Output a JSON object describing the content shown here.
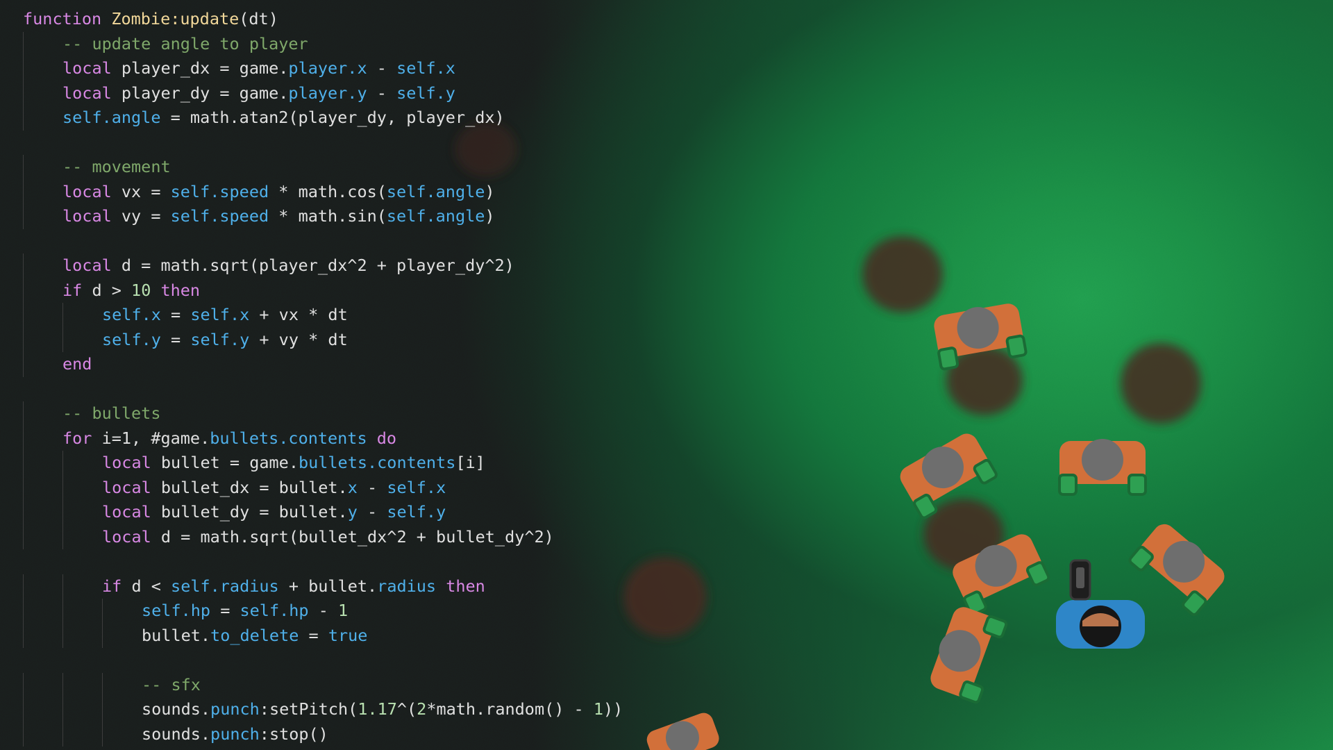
{
  "code_lines": [
    {
      "indent": 0,
      "segments": [
        {
          "t": "function ",
          "c": "kw"
        },
        {
          "t": "Zombie:update",
          "c": "fn"
        },
        {
          "t": "(dt)",
          "c": "lc"
        }
      ]
    },
    {
      "indent": 1,
      "segments": [
        {
          "t": "-- update angle to player",
          "c": "cm"
        }
      ]
    },
    {
      "indent": 1,
      "segments": [
        {
          "t": "local ",
          "c": "kw"
        },
        {
          "t": "player_dx = game.",
          "c": "lc"
        },
        {
          "t": "player.x",
          "c": "sf"
        },
        {
          "t": " - ",
          "c": "lc"
        },
        {
          "t": "self",
          "c": "sf"
        },
        {
          "t": ".x",
          "c": "sf"
        }
      ]
    },
    {
      "indent": 1,
      "segments": [
        {
          "t": "local ",
          "c": "kw"
        },
        {
          "t": "player_dy = game.",
          "c": "lc"
        },
        {
          "t": "player.y",
          "c": "sf"
        },
        {
          "t": " - ",
          "c": "lc"
        },
        {
          "t": "self",
          "c": "sf"
        },
        {
          "t": ".y",
          "c": "sf"
        }
      ]
    },
    {
      "indent": 1,
      "segments": [
        {
          "t": "self",
          "c": "sf"
        },
        {
          "t": ".angle",
          "c": "sf"
        },
        {
          "t": " = math.atan2(player_dy, player_dx)",
          "c": "lc"
        }
      ]
    },
    {
      "indent": 0,
      "segments": []
    },
    {
      "indent": 1,
      "segments": [
        {
          "t": "-- movement",
          "c": "cm"
        }
      ]
    },
    {
      "indent": 1,
      "segments": [
        {
          "t": "local ",
          "c": "kw"
        },
        {
          "t": "vx = ",
          "c": "lc"
        },
        {
          "t": "self",
          "c": "sf"
        },
        {
          "t": ".speed",
          "c": "sf"
        },
        {
          "t": " * math.cos(",
          "c": "lc"
        },
        {
          "t": "self",
          "c": "sf"
        },
        {
          "t": ".angle",
          "c": "sf"
        },
        {
          "t": ")",
          "c": "lc"
        }
      ]
    },
    {
      "indent": 1,
      "segments": [
        {
          "t": "local ",
          "c": "kw"
        },
        {
          "t": "vy = ",
          "c": "lc"
        },
        {
          "t": "self",
          "c": "sf"
        },
        {
          "t": ".speed",
          "c": "sf"
        },
        {
          "t": " * math.sin(",
          "c": "lc"
        },
        {
          "t": "self",
          "c": "sf"
        },
        {
          "t": ".angle",
          "c": "sf"
        },
        {
          "t": ")",
          "c": "lc"
        }
      ]
    },
    {
      "indent": 0,
      "segments": []
    },
    {
      "indent": 1,
      "segments": [
        {
          "t": "local ",
          "c": "kw"
        },
        {
          "t": "d = math.sqrt(player_dx^2 + player_dy^2)",
          "c": "lc"
        }
      ]
    },
    {
      "indent": 1,
      "segments": [
        {
          "t": "if ",
          "c": "kw"
        },
        {
          "t": "d > ",
          "c": "lc"
        },
        {
          "t": "10",
          "c": "nm"
        },
        {
          "t": " then",
          "c": "kw"
        }
      ]
    },
    {
      "indent": 2,
      "segments": [
        {
          "t": "self",
          "c": "sf"
        },
        {
          "t": ".x",
          "c": "sf"
        },
        {
          "t": " = ",
          "c": "lc"
        },
        {
          "t": "self",
          "c": "sf"
        },
        {
          "t": ".x",
          "c": "sf"
        },
        {
          "t": " + vx * dt",
          "c": "lc"
        }
      ]
    },
    {
      "indent": 2,
      "segments": [
        {
          "t": "self",
          "c": "sf"
        },
        {
          "t": ".y",
          "c": "sf"
        },
        {
          "t": " = ",
          "c": "lc"
        },
        {
          "t": "self",
          "c": "sf"
        },
        {
          "t": ".y",
          "c": "sf"
        },
        {
          "t": " + vy * dt",
          "c": "lc"
        }
      ]
    },
    {
      "indent": 1,
      "segments": [
        {
          "t": "end",
          "c": "kw"
        }
      ]
    },
    {
      "indent": 0,
      "segments": []
    },
    {
      "indent": 1,
      "segments": [
        {
          "t": "-- bullets",
          "c": "cm"
        }
      ]
    },
    {
      "indent": 1,
      "segments": [
        {
          "t": "for ",
          "c": "kw"
        },
        {
          "t": "i=1, #game.",
          "c": "lc"
        },
        {
          "t": "bullets.contents",
          "c": "sf"
        },
        {
          "t": " do",
          "c": "kw"
        }
      ]
    },
    {
      "indent": 2,
      "segments": [
        {
          "t": "local ",
          "c": "kw"
        },
        {
          "t": "bullet = game.",
          "c": "lc"
        },
        {
          "t": "bullets.contents",
          "c": "sf"
        },
        {
          "t": "[i]",
          "c": "lc"
        }
      ]
    },
    {
      "indent": 2,
      "segments": [
        {
          "t": "local ",
          "c": "kw"
        },
        {
          "t": "bullet_dx = bullet.",
          "c": "lc"
        },
        {
          "t": "x",
          "c": "sf"
        },
        {
          "t": " - ",
          "c": "lc"
        },
        {
          "t": "self",
          "c": "sf"
        },
        {
          "t": ".x",
          "c": "sf"
        }
      ]
    },
    {
      "indent": 2,
      "segments": [
        {
          "t": "local ",
          "c": "kw"
        },
        {
          "t": "bullet_dy = bullet.",
          "c": "lc"
        },
        {
          "t": "y",
          "c": "sf"
        },
        {
          "t": " - ",
          "c": "lc"
        },
        {
          "t": "self",
          "c": "sf"
        },
        {
          "t": ".y",
          "c": "sf"
        }
      ]
    },
    {
      "indent": 2,
      "segments": [
        {
          "t": "local ",
          "c": "kw"
        },
        {
          "t": "d = math.sqrt(bullet_dx^2 + bullet_dy^2)",
          "c": "lc"
        }
      ]
    },
    {
      "indent": 0,
      "segments": []
    },
    {
      "indent": 2,
      "segments": [
        {
          "t": "if ",
          "c": "kw"
        },
        {
          "t": "d < ",
          "c": "lc"
        },
        {
          "t": "self",
          "c": "sf"
        },
        {
          "t": ".radius",
          "c": "sf"
        },
        {
          "t": " + bullet.",
          "c": "lc"
        },
        {
          "t": "radius",
          "c": "sf"
        },
        {
          "t": " then",
          "c": "kw"
        }
      ]
    },
    {
      "indent": 3,
      "segments": [
        {
          "t": "self",
          "c": "sf"
        },
        {
          "t": ".hp",
          "c": "sf"
        },
        {
          "t": " = ",
          "c": "lc"
        },
        {
          "t": "self",
          "c": "sf"
        },
        {
          "t": ".hp",
          "c": "sf"
        },
        {
          "t": " - ",
          "c": "lc"
        },
        {
          "t": "1",
          "c": "nm"
        }
      ]
    },
    {
      "indent": 3,
      "segments": [
        {
          "t": "bullet.",
          "c": "lc"
        },
        {
          "t": "to_delete",
          "c": "sf"
        },
        {
          "t": " = ",
          "c": "lc"
        },
        {
          "t": "true",
          "c": "tr"
        }
      ]
    },
    {
      "indent": 0,
      "segments": []
    },
    {
      "indent": 3,
      "segments": [
        {
          "t": "-- sfx",
          "c": "cm"
        }
      ]
    },
    {
      "indent": 3,
      "segments": [
        {
          "t": "sounds.",
          "c": "lc"
        },
        {
          "t": "punch",
          "c": "sf"
        },
        {
          "t": ":setPitch(",
          "c": "lc"
        },
        {
          "t": "1.17",
          "c": "nm"
        },
        {
          "t": "^(",
          "c": "lc"
        },
        {
          "t": "2",
          "c": "nm"
        },
        {
          "t": "*math.random() - ",
          "c": "lc"
        },
        {
          "t": "1",
          "c": "nm"
        },
        {
          "t": "))",
          "c": "lc"
        }
      ]
    },
    {
      "indent": 3,
      "segments": [
        {
          "t": "sounds.",
          "c": "lc"
        },
        {
          "t": "punch",
          "c": "sf"
        },
        {
          "t": ":stop()",
          "c": "lc"
        }
      ]
    }
  ],
  "colors": {
    "background": "#1c1c1c",
    "grass": "#1e9448",
    "zombie_shirt": "#d2703a",
    "zombie_skin": "#2ea052",
    "zombie_head": "#6e6e6e",
    "blood": "#4a2a24",
    "player_shirt": "#2e86c8",
    "player_hair": "#161616"
  },
  "scene": {
    "entities": [
      "zombie",
      "zombie",
      "zombie",
      "zombie",
      "zombie",
      "zombie",
      "zombie",
      "player"
    ],
    "icons": [
      "blood-splat-icon",
      "zombie-icon",
      "player-icon",
      "gun-icon"
    ]
  }
}
